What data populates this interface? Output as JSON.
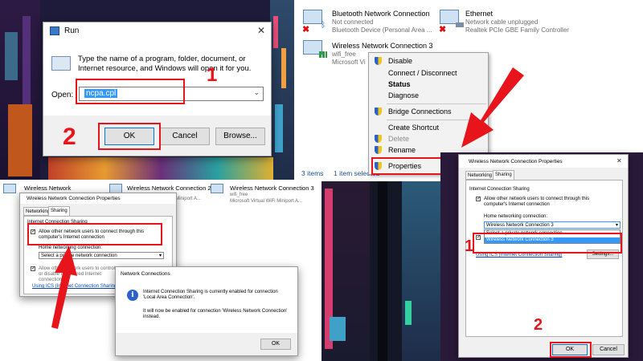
{
  "run": {
    "title": "Run",
    "description": "Type the name of a program, folder, document, or Internet resource, and Windows will open it for you.",
    "open_label": "Open:",
    "open_value": "ncpa.cpl",
    "ok": "OK",
    "cancel": "Cancel",
    "browse": "Browse..."
  },
  "netlist": {
    "items": [
      {
        "name": "Bluetooth Network Connection",
        "status": "Not connected",
        "device": "Bluetooth Device (Personal Area ..."
      },
      {
        "name": "Ethernet",
        "status": "Network cable unplugged",
        "device": "Realtek PCIe GBE Family Controller"
      },
      {
        "name": "Wireless Network Connection 3",
        "status": "wifi_free",
        "device": "Microsoft Vi"
      }
    ],
    "status_items": "3 items",
    "status_selected": "1 item selected"
  },
  "context_menu": {
    "items": [
      "Disable",
      "Connect / Disconnect",
      "Status",
      "Diagnose",
      "Bridge Connections",
      "Create Shortcut",
      "Delete",
      "Rename",
      "Properties"
    ]
  },
  "bottom_left": {
    "net1": "Wireless Network Connection",
    "net2": "Wireless Network Connection 2",
    "net3": "Wireless Network Connection 3",
    "net3_status": "wifi_free",
    "net3_device": "Microsoft Virtual WiFi Miniport A...",
    "props_title": "Wireless Network Connection Properties",
    "tab_networking": "Networking",
    "tab_sharing": "Sharing",
    "ics_label": "Internet Connection Sharing",
    "allow_text": "Allow other network users to connect through this computer's Internet connection",
    "home_label": "Home networking connection:",
    "select_value": "Select a private network connection",
    "allow_ctrl_text": "Allow other network users to control or disable the shared Internet connection",
    "using_ics": "Using ICS (Internet Connection Sharing)",
    "bg_fragment": "Microsoft Virtual WiFi Miniport A..."
  },
  "dialog": {
    "title": "Network Connections",
    "line1": "Internet Connection Sharing is currently enabled for connection 'Local Area Connection'.",
    "line2": "It will now be enabled for connection 'Wireless Network Connection' instead.",
    "ok": "OK"
  },
  "props_right": {
    "title": "Wireless Network Connection Properties",
    "tab_networking": "Networking",
    "tab_sharing": "Sharing",
    "ics_label": "Internet Connection Sharing",
    "allow_text": "Allow other network users to connect through this computer's Internet connection",
    "home_label": "Home networking connection:",
    "select_value": "Wireless Network Connection 3",
    "option1": "Select a private network connection",
    "option2": "Wireless Network Connection 3",
    "using_ics": "Using ICS (Internet Connection Sharing)",
    "settings": "Settings...",
    "ok": "OK",
    "cancel": "Cancel"
  },
  "annotations": {
    "n1_run": "1",
    "n2_run": "2",
    "n1_props": "1",
    "n2_props": "2"
  },
  "colors": {
    "accent_red": "#e8141c",
    "selection_blue": "#3399ff",
    "menu_bg": "#f2f2f2"
  }
}
